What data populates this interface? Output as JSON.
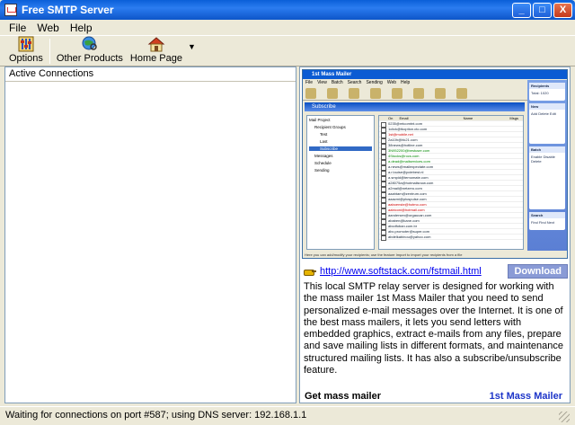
{
  "window": {
    "title": "Free SMTP Server",
    "minimize": "_",
    "maximize": "□",
    "close": "X"
  },
  "menu": [
    "File",
    "Web",
    "Help"
  ],
  "toolbar": {
    "options": "Options",
    "other_products": "Other Products",
    "home_page": "Home Page"
  },
  "left_panel": {
    "header": "Active Connections"
  },
  "ad": {
    "screenshot": {
      "title": "1st Mass Mailer",
      "menu": [
        "File",
        "View",
        "Batch",
        "Search",
        "Sending",
        "Web",
        "Help"
      ],
      "bar_title": "Subscribe",
      "tree": [
        "Mail Project",
        "Recipient Groups",
        "Test",
        "Last",
        "Subscribe",
        "Messages",
        "Schedule",
        "Sending"
      ],
      "grid_header": [
        "On",
        "Email",
        "Name",
        "Msgs"
      ],
      "rows": [
        {
          "email": "0235@mtcomtnt.com",
          "style": "normal"
        },
        {
          "email": "1click@tkoption.cto.com",
          "style": "normal"
        },
        {
          "email": "1st@mobile.net",
          "style": "red"
        },
        {
          "email": "2a10h@hk21.com",
          "style": "normal"
        },
        {
          "email": "38news@hotline.com",
          "style": "normal"
        },
        {
          "email": "3N952200@bestuser.com",
          "style": "green"
        },
        {
          "email": "4Stocks@rocs.com",
          "style": "green"
        },
        {
          "email": "a.dead@mailservices.com",
          "style": "green"
        },
        {
          "email": "a.news@mailexpectate.com",
          "style": "normal"
        },
        {
          "email": "a.r.louise@polebest.nl",
          "style": "normal"
        },
        {
          "email": "a.smpid@temomate.com",
          "style": "normal"
        },
        {
          "email": "a28075a@hotmailsnow.com",
          "style": "normal"
        },
        {
          "email": "a2mail@netzero.com",
          "style": "normal"
        },
        {
          "email": "aaahtam@zentrum.com",
          "style": "normal"
        },
        {
          "email": "aaacmi@pluspulse.com",
          "style": "normal"
        },
        {
          "email": "aaboenste@hotmo.com",
          "style": "red"
        },
        {
          "email": "aabiconi@hotmail.com",
          "style": "red"
        },
        {
          "email": "aandersen@orgaucan.com",
          "style": "normal"
        },
        {
          "email": "ababen@kane.com",
          "style": "normal"
        },
        {
          "email": "abcdfoban.com.br",
          "style": "normal"
        },
        {
          "email": "abc.promoter@super.com",
          "style": "normal"
        },
        {
          "email": "abdelkabinou@yahoo.com",
          "style": "normal"
        }
      ],
      "side_boxes": [
        {
          "title": "Recipients",
          "text": "Total: 1020"
        },
        {
          "title": "New",
          "text": "Add Delete Edit"
        },
        {
          "title": "Batch",
          "text": "Enable Disable Delete"
        },
        {
          "title": "Search",
          "text": "Find Find Next"
        }
      ],
      "status": "Here you can add/modify your recipients; use the feature Import to import your recipients from a file"
    },
    "link": "http://www.softstack.com/fstmail.html",
    "download": "Download",
    "description": "This local SMTP relay server is designed for working with the mass mailer 1st Mass Mailer that you need to send personalized e-mail messages over the Internet. It is one of the best mass mailers, it lets you send letters with embedded graphics, extract e-mails from any files, prepare and save mailing lists in different formats, and maintenance structured mailing lists. It has also a subscribe/unsubscribe feature.",
    "get": "Get mass mailer",
    "brand": "1st Mass Mailer"
  },
  "status": "Waiting for connections on port #587; using DNS server: 192.168.1.1",
  "colors": {
    "titlebar": "#0a5fd8",
    "brand": "#1c34c8",
    "download_bg": "#8a9bd6",
    "link": "#0000ee"
  }
}
